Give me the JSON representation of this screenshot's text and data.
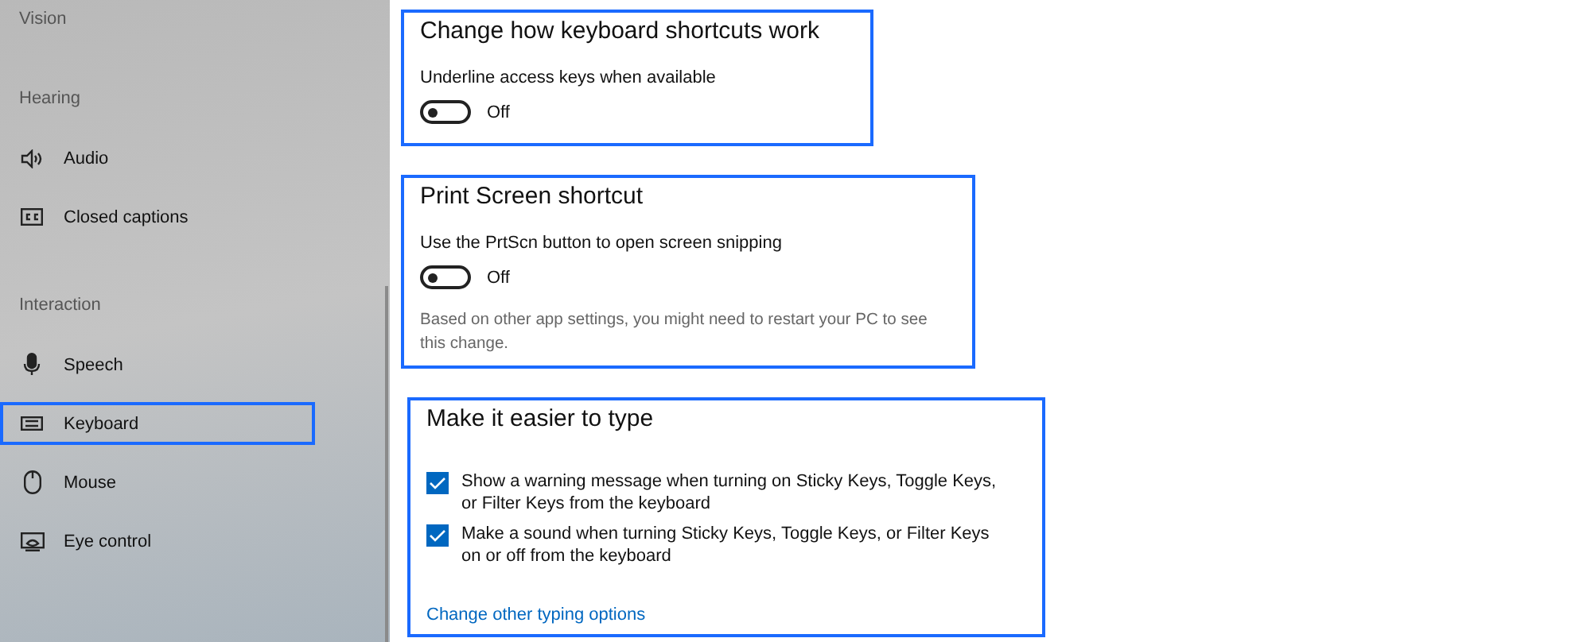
{
  "sidebar": {
    "groups": [
      {
        "header": "Vision"
      },
      {
        "header": "Hearing",
        "items": [
          {
            "label": "Audio",
            "kind": "speaker",
            "selected": false
          },
          {
            "label": "Closed captions",
            "kind": "captions",
            "selected": false
          }
        ]
      },
      {
        "header": "Interaction",
        "items": [
          {
            "label": "Speech",
            "kind": "mic",
            "selected": false
          },
          {
            "label": "Keyboard",
            "kind": "keyboard",
            "selected": true
          },
          {
            "label": "Mouse",
            "kind": "mouse",
            "selected": false
          },
          {
            "label": "Eye control",
            "kind": "eye",
            "selected": false
          }
        ]
      }
    ]
  },
  "sections": [
    {
      "title": "Change how keyboard shortcuts work",
      "items": [
        {
          "kind": "toggle",
          "label": "Underline access keys when available",
          "on": false,
          "state": "Off"
        }
      ]
    },
    {
      "title": "Print Screen shortcut",
      "items": [
        {
          "kind": "toggle",
          "label": "Use the PrtScn button to open screen snipping",
          "on": false,
          "state": "Off"
        },
        {
          "kind": "note",
          "text": "Based on other app settings, you might need to restart your PC to see this change."
        }
      ]
    },
    {
      "title": "Make it easier to type",
      "items": [
        {
          "kind": "checkbox",
          "label": "Show a warning message when turning on Sticky Keys, Toggle Keys, or Filter Keys from the keyboard",
          "checked": true
        },
        {
          "kind": "checkbox",
          "label": "Make a sound when turning Sticky Keys, Toggle Keys, or Filter Keys on or off from the keyboard",
          "checked": true
        },
        {
          "kind": "link",
          "text": "Change other typing options"
        }
      ]
    }
  ]
}
